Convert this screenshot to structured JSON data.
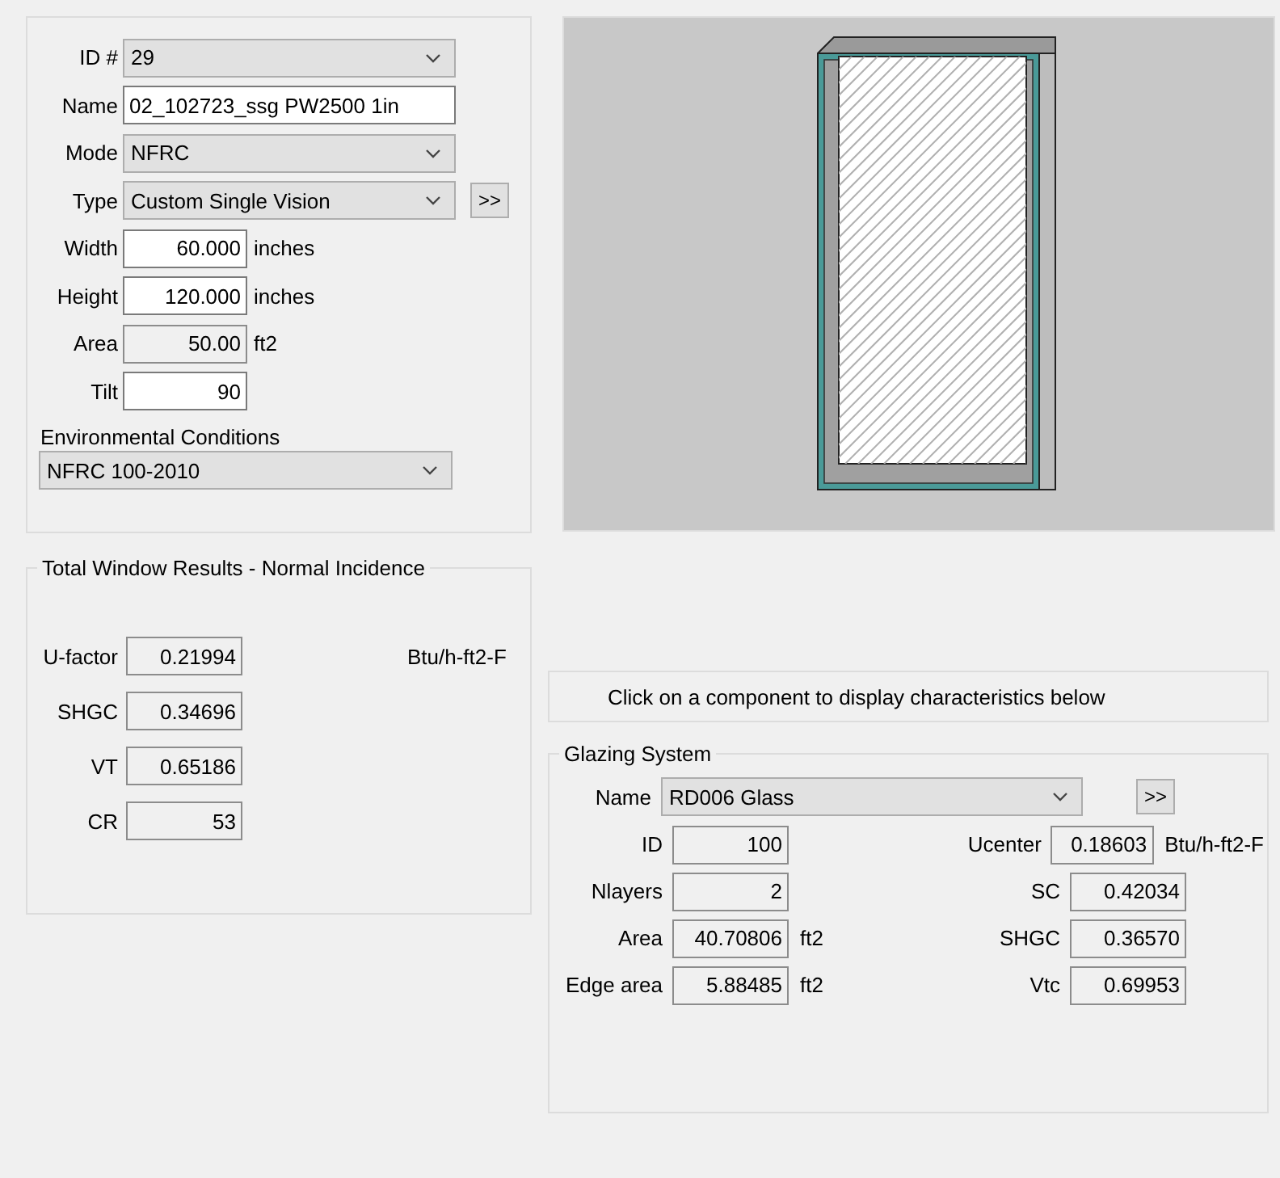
{
  "window_params": {
    "fields": [
      {
        "kind": "dropdown",
        "label": "ID #",
        "value": "29"
      },
      {
        "kind": "input",
        "label": "Name",
        "value": "02_102723_ssg PW2500 1in"
      },
      {
        "kind": "dropdown",
        "label": "Mode",
        "value": "NFRC"
      },
      {
        "kind": "dropdown",
        "label": "Type",
        "value": "Custom Single Vision",
        "more_button": ">>"
      },
      {
        "kind": "number",
        "label": "Width",
        "value": "60.000",
        "unit": "inches"
      },
      {
        "kind": "number",
        "label": "Height",
        "value": "120.000",
        "unit": "inches"
      },
      {
        "kind": "readonly",
        "label": "Area",
        "value": "50.00",
        "unit": "ft2"
      },
      {
        "kind": "number",
        "label": "Tilt",
        "value": "90"
      }
    ],
    "environment": {
      "label": "Environmental Conditions",
      "value": "NFRC 100-2010"
    }
  },
  "preview": {
    "kind": "window-drawing"
  },
  "results": {
    "title": "Total Window Results - Normal Incidence",
    "unit": "Btu/h-ft2-F",
    "rows": [
      {
        "label": "U-factor",
        "value": "0.21994"
      },
      {
        "label": "SHGC",
        "value": "0.34696"
      },
      {
        "label": "VT",
        "value": "0.65186"
      },
      {
        "label": "CR",
        "value": "53"
      }
    ]
  },
  "info_text": "Click on a component to display characteristics below",
  "glazing_system": {
    "title": "Glazing System",
    "name_label": "Name",
    "name_value": "RD006 Glass",
    "more_button": ">>",
    "unit": "Btu/h-ft2-F",
    "left_fields": [
      {
        "label": "ID",
        "value": "100"
      },
      {
        "label": "Nlayers",
        "value": "2"
      },
      {
        "label": "Area",
        "value": "40.70806",
        "unit": "ft2"
      },
      {
        "label": "Edge area",
        "value": "5.88485",
        "unit": "ft2"
      }
    ],
    "right_fields": [
      {
        "label": "Ucenter",
        "value": "0.18603"
      },
      {
        "label": "SC",
        "value": "0.42034"
      },
      {
        "label": "SHGC",
        "value": "0.36570"
      },
      {
        "label": "Vtc",
        "value": "0.69953"
      }
    ]
  }
}
